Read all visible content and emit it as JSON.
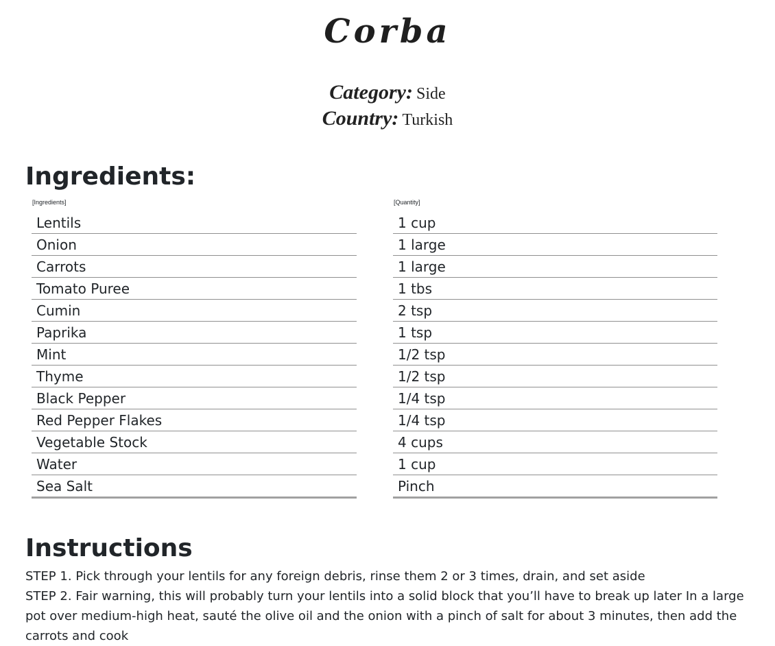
{
  "recipe": {
    "title": "Corba",
    "category_label": "Category:",
    "category_value": "Side",
    "country_label": "Country:",
    "country_value": "Turkish"
  },
  "ingredients_section": {
    "heading": "Ingredients:",
    "column_ingredients": "[Ingredients]",
    "column_quantity": "[Quantity]",
    "items": [
      {
        "name": "Lentils",
        "quantity": "1 cup"
      },
      {
        "name": "Onion",
        "quantity": "1 large"
      },
      {
        "name": "Carrots",
        "quantity": "1 large"
      },
      {
        "name": "Tomato Puree",
        "quantity": "1 tbs"
      },
      {
        "name": "Cumin",
        "quantity": "2 tsp"
      },
      {
        "name": "Paprika",
        "quantity": "1 tsp"
      },
      {
        "name": "Mint",
        "quantity": "1/2 tsp"
      },
      {
        "name": "Thyme",
        "quantity": "1/2 tsp"
      },
      {
        "name": "Black Pepper",
        "quantity": "1/4 tsp"
      },
      {
        "name": "Red Pepper Flakes",
        "quantity": "1/4 tsp"
      },
      {
        "name": "Vegetable Stock",
        "quantity": "4 cups"
      },
      {
        "name": "Water",
        "quantity": "1 cup"
      },
      {
        "name": "Sea Salt",
        "quantity": "Pinch"
      }
    ]
  },
  "instructions_section": {
    "heading": "Instructions",
    "steps": [
      "STEP 1. Pick through your lentils for any foreign debris, rinse them 2 or 3 times, drain, and set aside",
      "STEP 2. Fair warning, this will probably turn your lentils into a solid block that you’ll have to break up later In a large pot over medium-high heat, sauté the olive oil and the onion with a pinch of salt for about 3 minutes, then add the carrots and cook"
    ]
  }
}
